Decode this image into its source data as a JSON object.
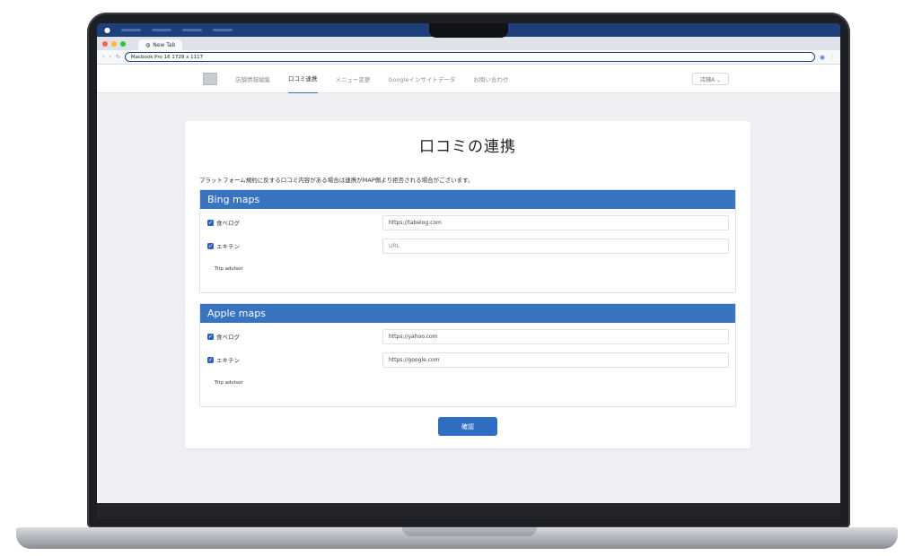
{
  "browser": {
    "tab_title": "New Tab",
    "url": "Macbook Pro 16 1728 x 1117"
  },
  "nav": {
    "items": [
      {
        "label": "店舗情報編集",
        "active": false
      },
      {
        "label": "口コミ連携",
        "active": true
      },
      {
        "label": "メニュー変更",
        "active": false
      },
      {
        "label": "Googleインサイトデータ",
        "active": false
      },
      {
        "label": "お問い合わせ",
        "active": false
      }
    ],
    "user_menu": "店舗A ⌄"
  },
  "page": {
    "title": "口コミの連携",
    "description": "プラットフォーム規約に反する口コミ内容がある場合は連携がMAP側より拒否される場合がございます。"
  },
  "sections": [
    {
      "name": "Bing maps",
      "rows": [
        {
          "label": "食べログ",
          "checked": true,
          "value": "https://tabelog.com",
          "placeholder": ""
        },
        {
          "label": "エキテン",
          "checked": true,
          "value": "",
          "placeholder": "URL"
        },
        {
          "label": "Trip advisor",
          "checked": false
        }
      ]
    },
    {
      "name": "Apple maps",
      "rows": [
        {
          "label": "食べログ",
          "checked": true,
          "value": "https://yahoo.com",
          "placeholder": ""
        },
        {
          "label": "エキテン",
          "checked": true,
          "value": "https://google.com",
          "placeholder": ""
        },
        {
          "label": "Trip advisor",
          "checked": false
        }
      ]
    }
  ],
  "confirm_label": "確認",
  "colors": {
    "accent": "#3874c0",
    "checkbox": "#2f63b8",
    "menubar": "#1f3f7a"
  }
}
